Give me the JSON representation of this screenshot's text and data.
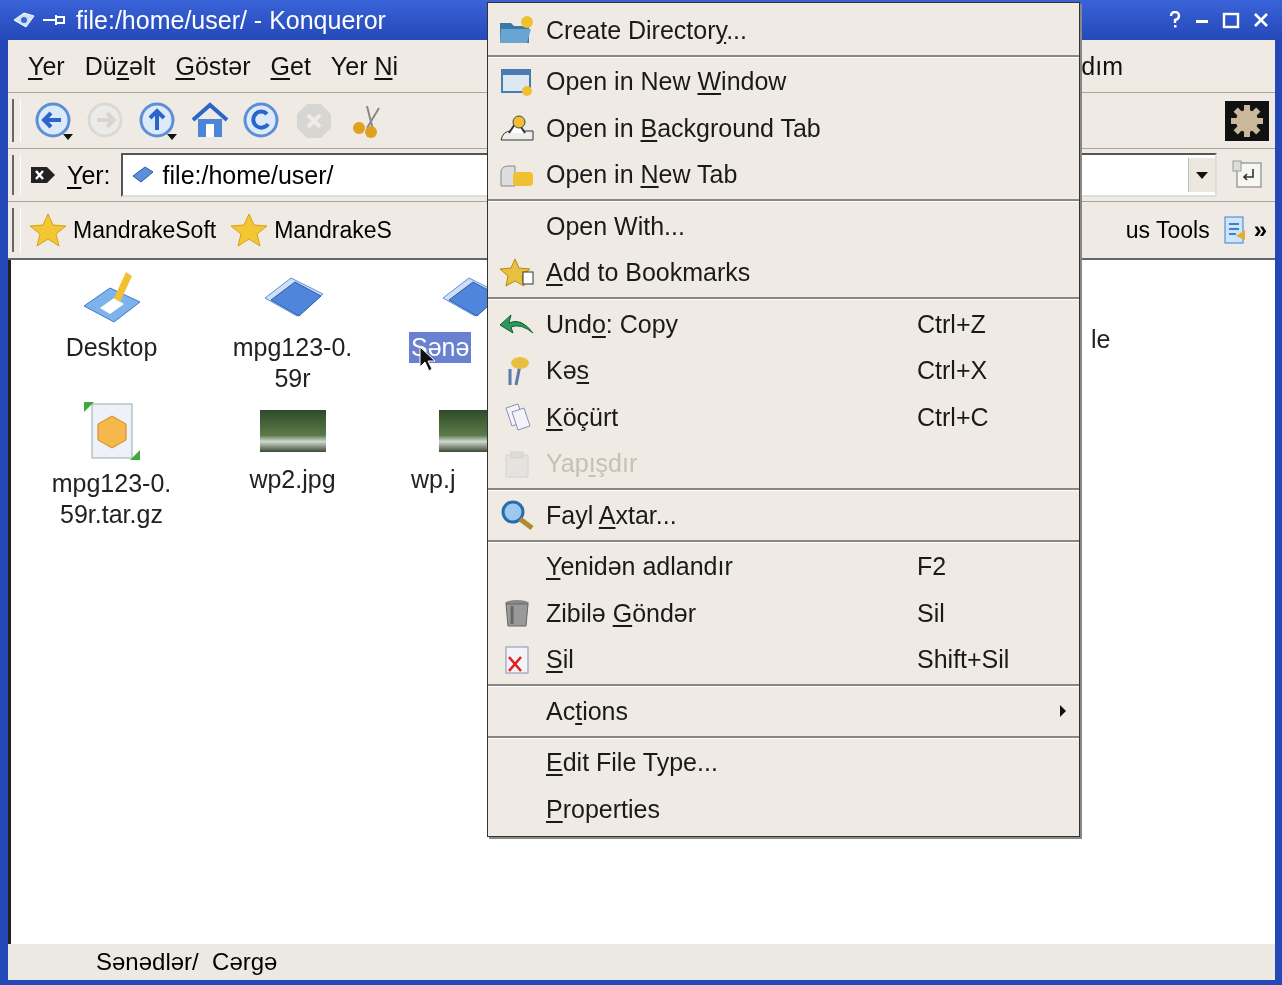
{
  "window": {
    "title": "file:/home/user/ - Konqueror"
  },
  "menubar": {
    "items": [
      {
        "segments": [
          {
            "text": "Y",
            "underlined": true
          },
          {
            "text": "er",
            "underlined": false
          }
        ]
      },
      {
        "segments": [
          {
            "text": "Dü",
            "underlined": false
          },
          {
            "text": "z",
            "underlined": true
          },
          {
            "text": "əlt",
            "underlined": false
          }
        ]
      },
      {
        "segments": [
          {
            "text": "G",
            "underlined": true
          },
          {
            "text": "östər",
            "underlined": false
          }
        ]
      },
      {
        "segments": [
          {
            "text": "G",
            "underlined": true
          },
          {
            "text": "et",
            "underlined": false
          }
        ]
      },
      {
        "segments": [
          {
            "text": "Yer ",
            "underlined": false
          },
          {
            "text": "N",
            "underlined": true
          },
          {
            "text": "i",
            "underlined": false
          }
        ]
      }
    ],
    "trailing": "dım"
  },
  "toolbar": {
    "buttons": [
      {
        "disabled": false
      },
      {
        "disabled": true
      },
      {
        "disabled": false
      },
      {
        "disabled": false
      },
      {
        "disabled": false
      },
      {
        "disabled": true
      },
      {
        "disabled": false
      }
    ]
  },
  "location_bar": {
    "label": [
      {
        "text": "Y",
        "underlined": true
      },
      {
        "text": "er:",
        "underlined": false
      }
    ],
    "value": "file:/home/user/"
  },
  "bookmarks_bar": {
    "items": [
      {
        "label": "MandrakeSoft"
      },
      {
        "label": "MandrakeS"
      }
    ],
    "trailing": "us Tools",
    "overflow": "»"
  },
  "files": {
    "rows": [
      {
        "items": [
          {
            "name": "Desktop",
            "selected": false
          },
          {
            "name": "mpg123-0.\n59r",
            "selected": false
          },
          {
            "name": "Sənə",
            "selected": true
          },
          {
            "name": "le",
            "selected": false
          }
        ]
      },
      {
        "items": [
          {
            "name": "mpg123-0.\n59r.tar.gz",
            "selected": false
          },
          {
            "name": "wp2.jpg",
            "selected": false
          },
          {
            "name": "wp.j",
            "selected": false
          }
        ]
      }
    ]
  },
  "context_menu": {
    "sections": [
      [
        {
          "kind": "command",
          "disabled": false,
          "segments": [
            {
              "text": "Create Director",
              "underlined": false
            },
            {
              "text": "y",
              "underlined": true
            },
            {
              "text": "...",
              "underlined": false
            }
          ]
        }
      ],
      [
        {
          "kind": "command",
          "disabled": false,
          "segments": [
            {
              "text": "Open in New ",
              "underlined": false
            },
            {
              "text": "W",
              "underlined": true
            },
            {
              "text": "indow",
              "underlined": false
            }
          ]
        },
        {
          "kind": "command",
          "disabled": false,
          "segments": [
            {
              "text": "Open in ",
              "underlined": false
            },
            {
              "text": "B",
              "underlined": true
            },
            {
              "text": "ackground Tab",
              "underlined": false
            }
          ]
        },
        {
          "kind": "command",
          "disabled": false,
          "segments": [
            {
              "text": "Open in ",
              "underlined": false
            },
            {
              "text": "N",
              "underlined": true
            },
            {
              "text": "ew Tab",
              "underlined": false
            }
          ]
        }
      ],
      [
        {
          "kind": "command",
          "disabled": false,
          "segments": [
            {
              "text": "Open With...",
              "underlined": false
            }
          ]
        },
        {
          "kind": "command",
          "disabled": false,
          "segments": [
            {
              "text": "A",
              "underlined": true
            },
            {
              "text": "dd to Bookmarks",
              "underlined": false
            }
          ]
        }
      ],
      [
        {
          "kind": "command",
          "disabled": false,
          "shortcut": "Ctrl+Z",
          "segments": [
            {
              "text": "Und",
              "underlined": false
            },
            {
              "text": "o",
              "underlined": true
            },
            {
              "text": ": Copy",
              "underlined": false
            }
          ]
        },
        {
          "kind": "command",
          "disabled": false,
          "shortcut": "Ctrl+X",
          "segments": [
            {
              "text": "Kə",
              "underlined": false
            },
            {
              "text": "s",
              "underlined": true
            }
          ]
        },
        {
          "kind": "command",
          "disabled": false,
          "shortcut": "Ctrl+C",
          "segments": [
            {
              "text": "K",
              "underlined": true
            },
            {
              "text": "öçürt",
              "underlined": false
            }
          ]
        },
        {
          "kind": "command",
          "disabled": true,
          "segments": [
            {
              "text": "Yap",
              "underlined": false
            },
            {
              "text": "ı",
              "underlined": true
            },
            {
              "text": "şdır",
              "underlined": false
            }
          ]
        }
      ],
      [
        {
          "kind": "command",
          "disabled": false,
          "segments": [
            {
              "text": "Fayl ",
              "underlined": false
            },
            {
              "text": "A",
              "underlined": true
            },
            {
              "text": "xtar...",
              "underlined": false
            }
          ]
        }
      ],
      [
        {
          "kind": "command",
          "disabled": false,
          "shortcut": "F2",
          "segments": [
            {
              "text": "Y",
              "underlined": true
            },
            {
              "text": "enidən adlandır",
              "underlined": false
            }
          ]
        },
        {
          "kind": "command",
          "disabled": false,
          "shortcut": "Sil",
          "segments": [
            {
              "text": "Zibilə ",
              "underlined": false
            },
            {
              "text": "G",
              "underlined": true
            },
            {
              "text": "öndər",
              "underlined": false
            }
          ]
        },
        {
          "kind": "command",
          "disabled": false,
          "shortcut": "Shift+Sil",
          "segments": [
            {
              "text": "S",
              "underlined": true
            },
            {
              "text": "il",
              "underlined": false
            }
          ]
        }
      ],
      [
        {
          "kind": "submenu",
          "disabled": false,
          "segments": [
            {
              "text": "Ac",
              "underlined": false
            },
            {
              "text": "t",
              "underlined": true
            },
            {
              "text": "ions",
              "underlined": false
            }
          ]
        }
      ],
      [
        {
          "kind": "command",
          "disabled": false,
          "segments": [
            {
              "text": "E",
              "underlined": true
            },
            {
              "text": "dit File Type...",
              "underlined": false
            }
          ]
        },
        {
          "kind": "command",
          "disabled": false,
          "segments": [
            {
              "text": "P",
              "underlined": true
            },
            {
              "text": "roperties",
              "underlined": false
            }
          ]
        }
      ]
    ]
  },
  "status_bar": {
    "text": "Sənədlər/  Cərgə"
  }
}
